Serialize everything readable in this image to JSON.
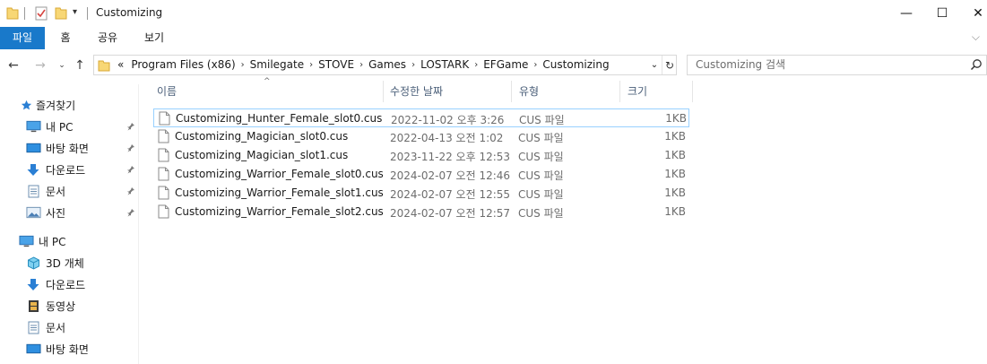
{
  "window": {
    "title": "Customizing",
    "minimize_glyph": "—",
    "maximize_glyph": "☐",
    "close_glyph": "✕"
  },
  "ribbon": {
    "tabs": [
      "파일",
      "홈",
      "공유",
      "보기"
    ]
  },
  "address": {
    "overflow": "«",
    "path": [
      "Program Files (x86)",
      "Smilegate",
      "STOVE",
      "Games",
      "LOSTARK",
      "EFGame",
      "Customizing"
    ]
  },
  "search": {
    "placeholder": "Customizing 검색"
  },
  "nav": {
    "quick_access_label": "즐겨찾기",
    "quick_items": [
      {
        "label": "내 PC",
        "icon": "pc-icon"
      },
      {
        "label": "바탕 화면",
        "icon": "desktop-icon"
      },
      {
        "label": "다운로드",
        "icon": "download-icon"
      },
      {
        "label": "문서",
        "icon": "document-icon"
      },
      {
        "label": "사진",
        "icon": "pictures-icon"
      }
    ],
    "this_pc_label": "내 PC",
    "pc_items": [
      {
        "label": "3D 개체",
        "icon": "3d-objects-icon"
      },
      {
        "label": "다운로드",
        "icon": "download-icon"
      },
      {
        "label": "동영상",
        "icon": "videos-icon"
      },
      {
        "label": "문서",
        "icon": "document-icon"
      },
      {
        "label": "바탕 화면",
        "icon": "desktop-icon"
      }
    ]
  },
  "columns": {
    "name": "이름",
    "date": "수정한 날짜",
    "type": "유형",
    "size": "크기"
  },
  "files": [
    {
      "name": "Customizing_Hunter_Female_slot0.cus",
      "date": "2022-11-02 오후 3:26",
      "type": "CUS 파일",
      "size": "1KB",
      "selected": true
    },
    {
      "name": "Customizing_Magician_slot0.cus",
      "date": "2022-04-13 오전 1:02",
      "type": "CUS 파일",
      "size": "1KB"
    },
    {
      "name": "Customizing_Magician_slot1.cus",
      "date": "2023-11-22 오후 12:53",
      "type": "CUS 파일",
      "size": "1KB"
    },
    {
      "name": "Customizing_Warrior_Female_slot0.cus",
      "date": "2024-02-07 오전 12:46",
      "type": "CUS 파일",
      "size": "1KB"
    },
    {
      "name": "Customizing_Warrior_Female_slot1.cus",
      "date": "2024-02-07 오전 12:55",
      "type": "CUS 파일",
      "size": "1KB"
    },
    {
      "name": "Customizing_Warrior_Female_slot2.cus",
      "date": "2024-02-07 오전 12:57",
      "type": "CUS 파일",
      "size": "1KB"
    }
  ],
  "colors": {
    "accent": "#1979ca",
    "selection_border": "#99d1ff",
    "folder": "#f8d775",
    "header_text": "#4c607a"
  }
}
